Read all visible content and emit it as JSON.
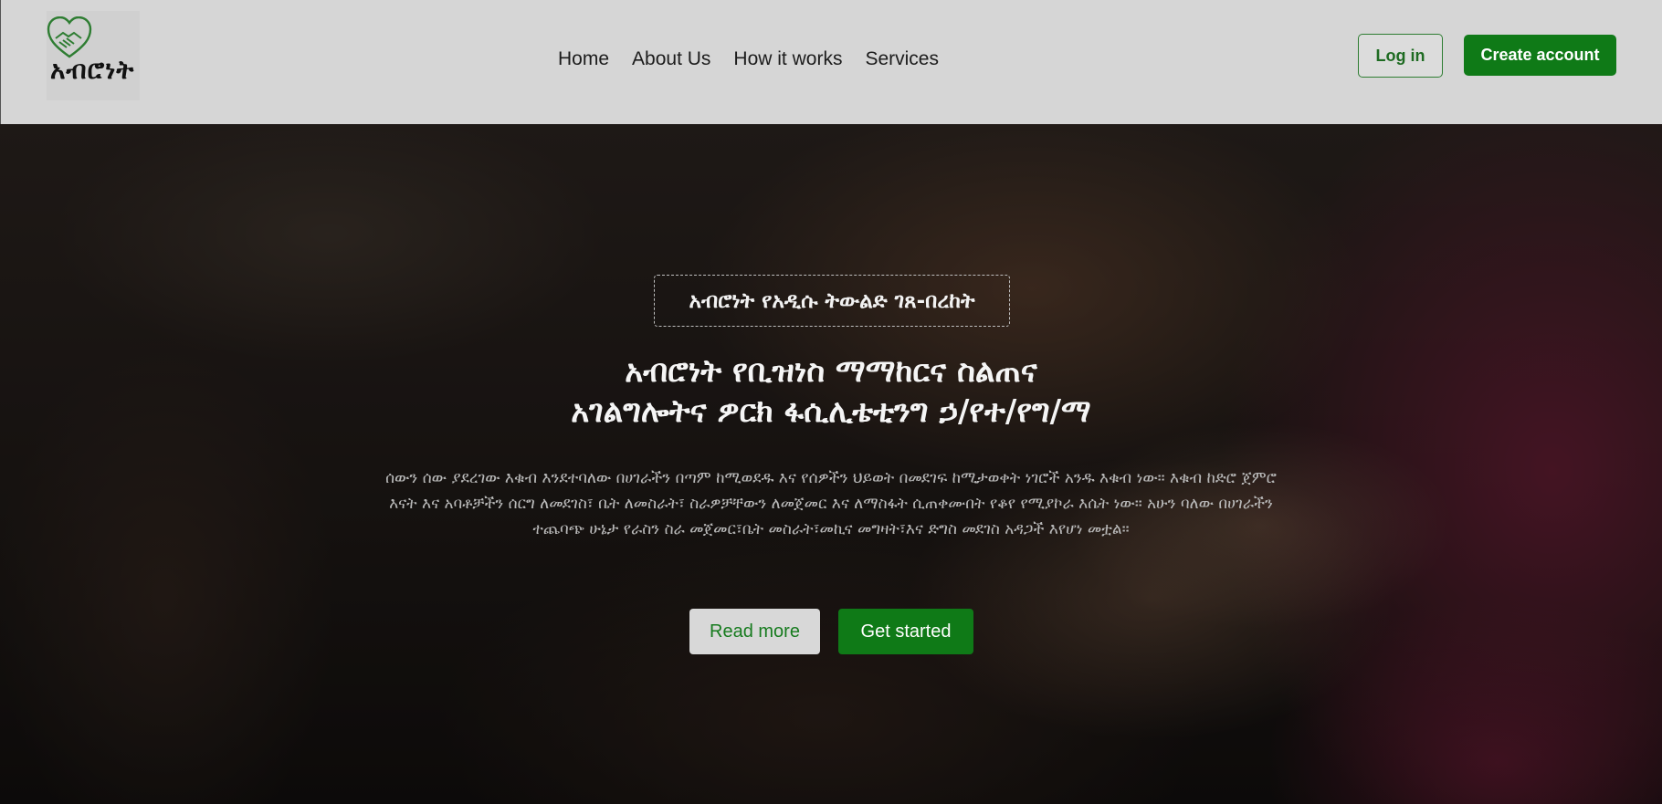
{
  "header": {
    "logo_text": "አብሮነት",
    "nav": [
      "Home",
      "About Us",
      "How it works",
      "Services"
    ],
    "login_label": "Log in",
    "create_label": "Create account"
  },
  "hero": {
    "tagline": "አብሮነት የአዲሱ ትውልድ ገጸ-በረከት",
    "title_line1": "አብሮነት የቢዝነስ ማማከርና ስልጠና",
    "title_line2": "አገልግሎትና ዎርክ ፋሲሊቴቲንግ ኃ/የተ/የግ/ማ",
    "description": "ሰውን ሰው ያደረገው እቁብ እንደተባለው በሀገራችን በጣም ከሚወደዱ እና የሰዎችን ህይወት በመደገፍ ከሚታወቀት ነገሮች አንዱ እቁብ ነው። እቁብ ከድሮ ጀምሮ እናት እና አባቶቻችን ሰርግ ለመደገስ፣ ቤት ለመስራት፣ ስራዎቻቸውን ለመጀመር እና ለማስፋት ሲጠቀሙበት የቆየ የሚያኮራ እሴት ነው። አሁን ባለው በሀገራችን ተጨባጭ ሁኔታ የራስን ስራ መጀመር፣ቤት መስራት፣መኪና መግዛት፣እና ድግስ መደገስ አዳጋች እየሆነ መቷል።",
    "read_more_label": "Read more",
    "get_started_label": "Get started"
  },
  "colors": {
    "brand_green": "#0f7a17",
    "header_bg": "#d6d6d6"
  }
}
